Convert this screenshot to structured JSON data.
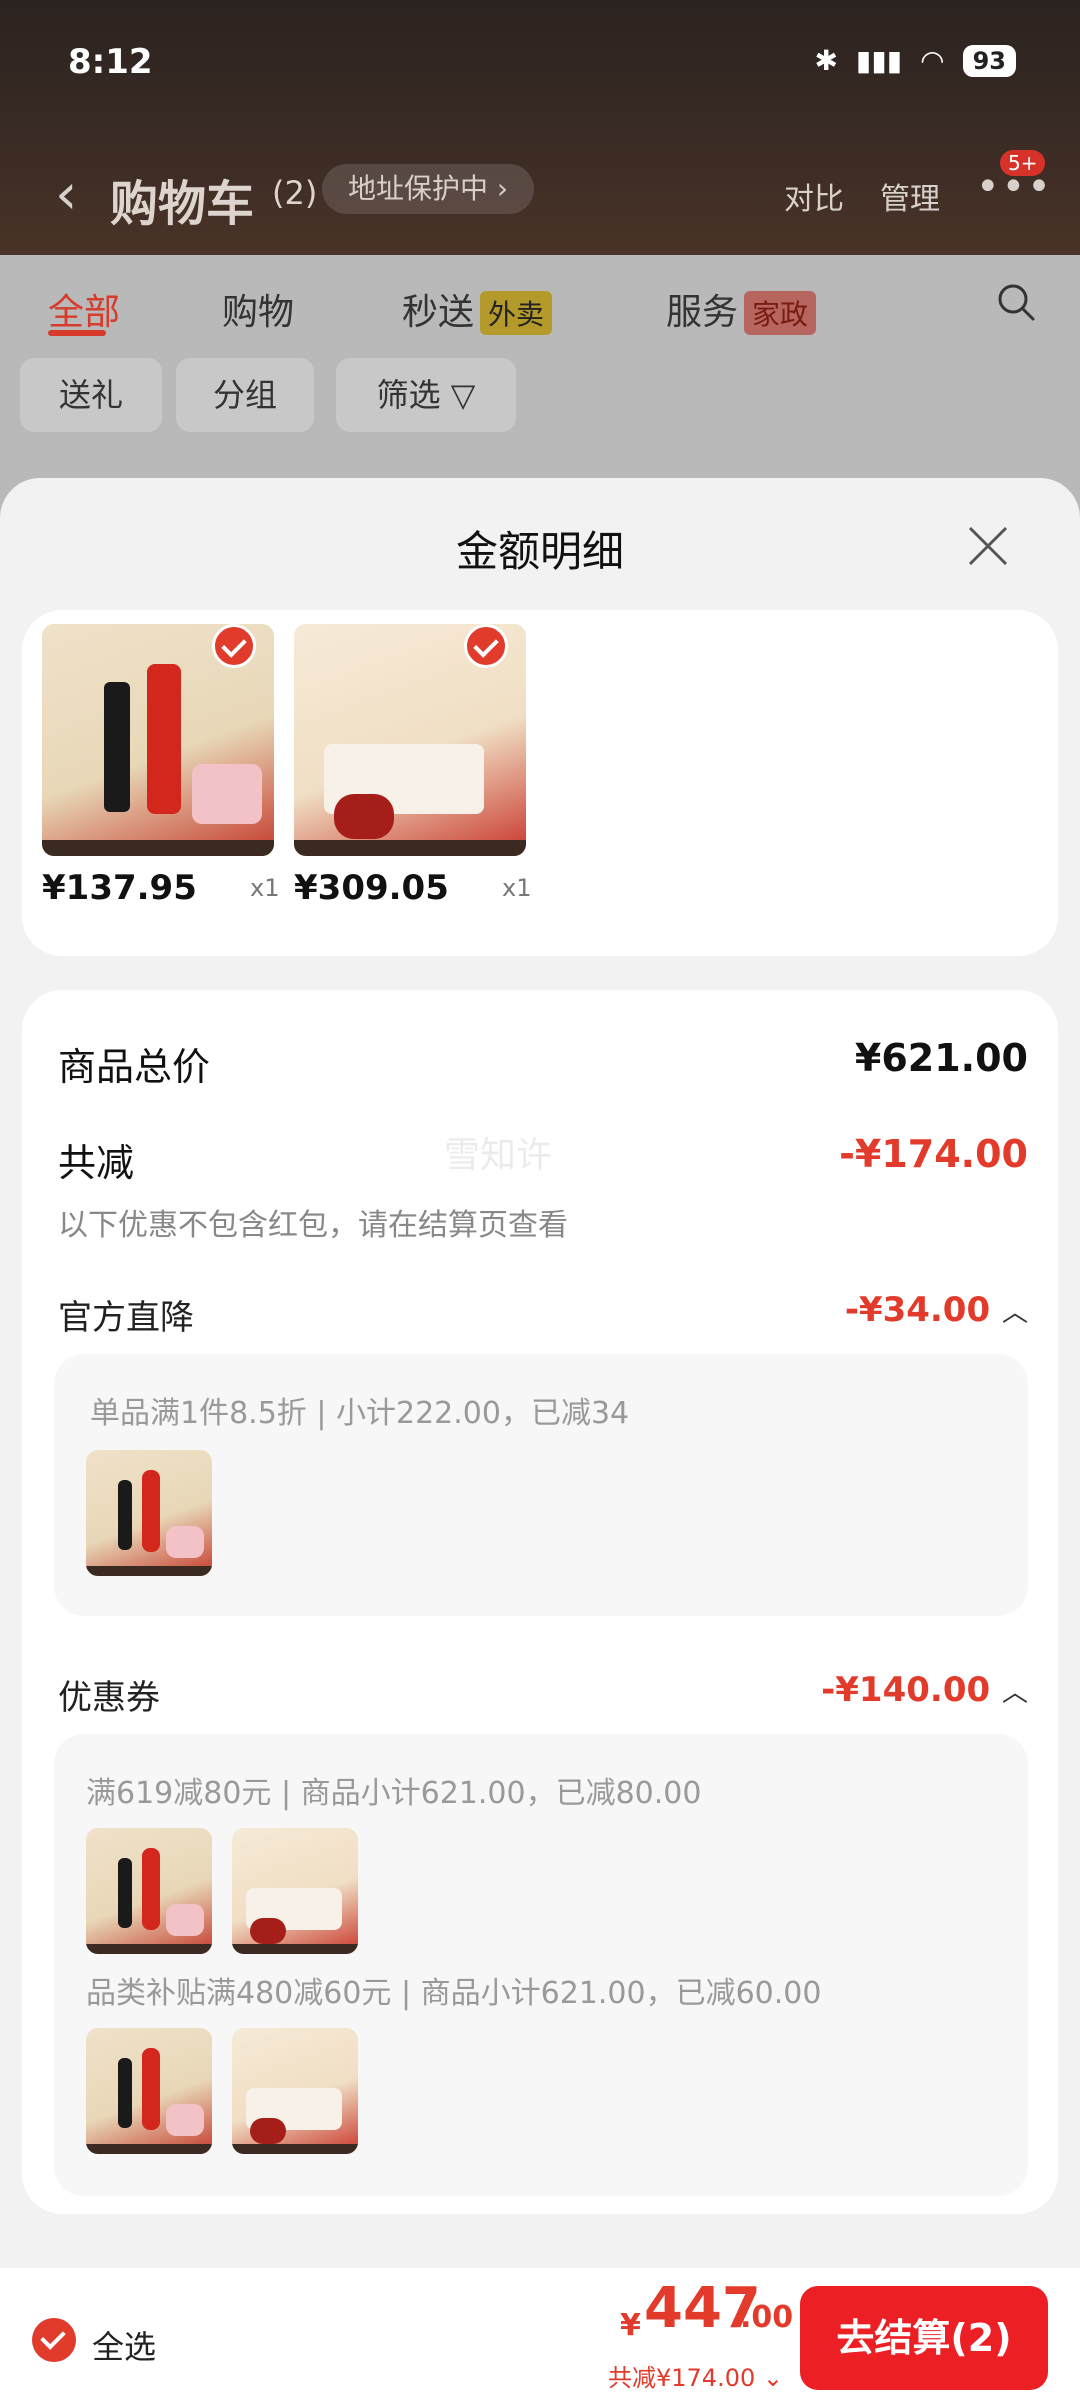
{
  "status_bar": {
    "time": "8:12",
    "icons": [
      "bluetooth-icon",
      "5ga-signal-icon",
      "5g-signal-icon",
      "wifi-icon"
    ],
    "battery": "93"
  },
  "cart_header": {
    "title": "购物车",
    "count": "(2)",
    "address_pill": "地址保护中 ›",
    "compare": "对比",
    "manage": "管理",
    "badge": "5+"
  },
  "tabs": [
    {
      "label": "全部",
      "active": true
    },
    {
      "label": "购物",
      "active": false
    },
    {
      "label": "秒送",
      "tag": "外卖",
      "active": false
    },
    {
      "label": "服务",
      "tag": "家政",
      "active": false
    }
  ],
  "filters": [
    "送礼",
    "分组",
    "筛选 ▽"
  ],
  "sheet": {
    "title": "金额明细",
    "items": [
      {
        "price": "¥137.95",
        "qty": "x1"
      },
      {
        "price": "¥309.05",
        "qty": "x1"
      }
    ],
    "summary": {
      "total_label": "商品总价",
      "total_value": "¥621.00",
      "discount_label": "共减",
      "discount_value": "-¥174.00",
      "note": "以下优惠不包含红包，请在结算页查看",
      "watermark": "雪知许"
    },
    "official": {
      "label": "官方直降",
      "value": "-¥34.00",
      "detail": "单品满1件8.5折 | 小计222.00，已减34"
    },
    "coupon": {
      "label": "优惠券",
      "value": "-¥140.00",
      "line1": "满619减80元 | 商品小计621.00，已减80.00",
      "line2": "品类补贴满480减60元 | 商品小计621.00，已减60.00"
    }
  },
  "bottom_bar": {
    "select_all": "全选",
    "yen": "¥",
    "total_int": "447",
    "total_dec": ".00",
    "total_sub": "共减¥174.00 ⌄",
    "checkout": "去结算(2)"
  },
  "colors": {
    "accent": "#e23b2c",
    "checkout": "#ec1f25"
  }
}
